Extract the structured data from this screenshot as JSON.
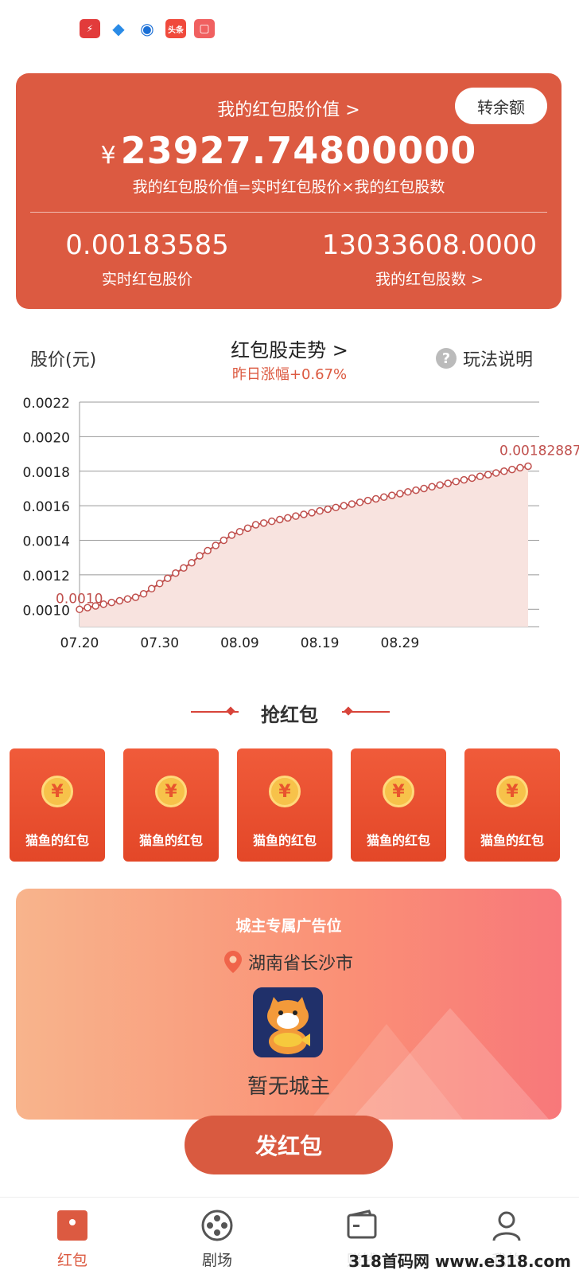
{
  "value_card": {
    "title": "我的红包股价值 >",
    "transfer_label": "转余额",
    "currency": "¥",
    "amount": "23927.74800000",
    "formula": "我的红包股价值=实时红包股价×我的红包股数",
    "price_value": "0.00183585",
    "price_label": "实时红包股价",
    "shares_value": "13033608.0000",
    "shares_label": "我的红包股数 >"
  },
  "chart_header": {
    "y_label": "股价(元)",
    "title": "红包股走势 >",
    "subtitle": "昨日涨幅+0.67%",
    "help_icon": "question-circle-icon",
    "help_label": "玩法说明"
  },
  "chart_data": {
    "type": "area",
    "ylim": [
      0.0009,
      0.0022
    ],
    "yticks": [
      "0.0010",
      "0.0012",
      "0.0014",
      "0.0016",
      "0.0018",
      "0.0020",
      "0.0022"
    ],
    "xticks": [
      "07.20",
      "07.30",
      "08.09",
      "08.19",
      "08.29"
    ],
    "grid": true,
    "start_label": "0.0010",
    "end_label": "0.00182887",
    "values": [
      0.001,
      0.00101,
      0.00102,
      0.00103,
      0.00104,
      0.00105,
      0.00106,
      0.00107,
      0.00109,
      0.00112,
      0.00115,
      0.00118,
      0.00121,
      0.00124,
      0.00127,
      0.00131,
      0.00134,
      0.00137,
      0.0014,
      0.00143,
      0.00145,
      0.00147,
      0.00149,
      0.0015,
      0.00151,
      0.00152,
      0.00153,
      0.00154,
      0.00155,
      0.00156,
      0.00157,
      0.00158,
      0.00159,
      0.0016,
      0.00161,
      0.00162,
      0.00163,
      0.00164,
      0.00165,
      0.00166,
      0.00167,
      0.00168,
      0.00169,
      0.0017,
      0.00171,
      0.00172,
      0.00173,
      0.00174,
      0.00175,
      0.00176,
      0.00177,
      0.00178,
      0.00179,
      0.0018,
      0.00181,
      0.00182,
      0.00182887
    ]
  },
  "grab_section": {
    "title": "抢红包",
    "envelopes": [
      {
        "label": "猫鱼的红包",
        "coin": "¥"
      },
      {
        "label": "猫鱼的红包",
        "coin": "¥"
      },
      {
        "label": "猫鱼的红包",
        "coin": "¥"
      },
      {
        "label": "猫鱼的红包",
        "coin": "¥"
      },
      {
        "label": "猫鱼的红包",
        "coin": "¥"
      }
    ]
  },
  "ad_card": {
    "label": "城主专属广告位",
    "location": "湖南省长沙市",
    "location_icon": "map-pin-icon",
    "logo_icon": "cat-fish-logo-icon",
    "owner": "暂无城主"
  },
  "send_button": "发红包",
  "bottom_nav": [
    {
      "label": "红包",
      "icon": "red-envelope-icon",
      "active": true
    },
    {
      "label": "剧场",
      "icon": "film-reel-icon",
      "active": false
    },
    {
      "label": "赚钱",
      "icon": "wallet-icon",
      "active": false
    },
    {
      "label": "我的",
      "icon": "user-icon",
      "active": false
    }
  ],
  "watermark": "318首码网 www.e318.com",
  "colors": {
    "primary": "#dc5a41",
    "chart_line": "#c0504d",
    "chart_fill": "#f8e3df"
  }
}
